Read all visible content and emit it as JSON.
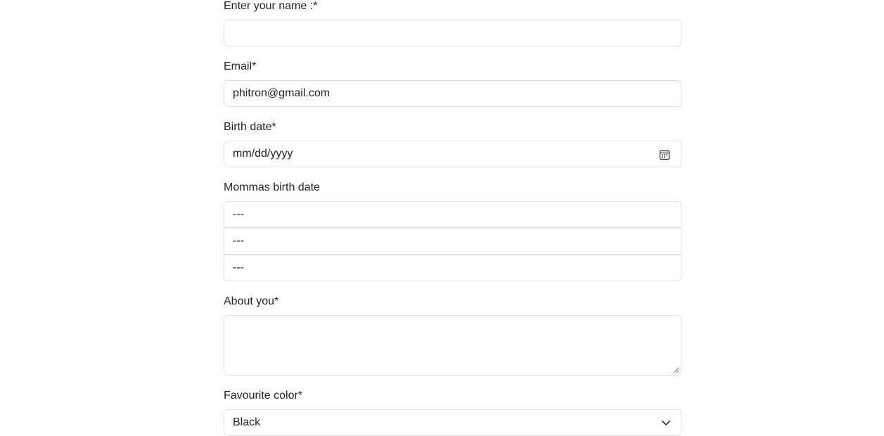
{
  "form": {
    "name": {
      "label": "Enter your name :*",
      "value": ""
    },
    "email": {
      "label": "Email*",
      "value": "phitron@gmail.com"
    },
    "birth_date": {
      "label": "Birth date*",
      "placeholder": "mm/dd/yyyy",
      "icon": "calendar-icon"
    },
    "mommas_birth_date": {
      "label": "Mommas birth date",
      "selects": [
        "---",
        "---",
        "---"
      ]
    },
    "about": {
      "label": "About you*",
      "value": ""
    },
    "favourite_color": {
      "label": "Favourite color*",
      "selected": "Black",
      "icon": "chevron-down-icon"
    }
  }
}
